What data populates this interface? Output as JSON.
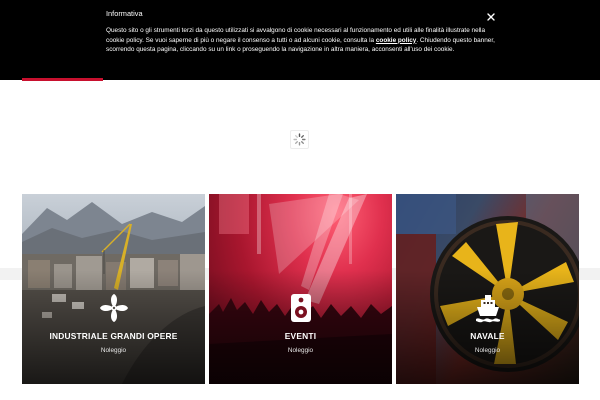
{
  "cookie_banner": {
    "title": "Informativa",
    "text_before_link": "Questo sito o gli strumenti terzi da questo utilizzati si avvalgono di cookie necessari al funzionamento ed utili alle finalità illustrate nella cookie policy. Se vuoi saperne di più o negare il consenso a tutti o ad alcuni cookie, consulta la ",
    "link_text": "cookie policy",
    "text_after_link": ". Chiudendo questo banner, scorrendo questa pagina, cliccando su un link o proseguendo la navigazione in altra maniera, acconsenti all'uso dei cookie.",
    "close_icon": "close-icon"
  },
  "loader": {
    "icon": "spinner-icon"
  },
  "cards": [
    {
      "title": "INDUSTRIALE GRANDI OPERE",
      "subtitle": "Noleggio",
      "icon": "fan-icon"
    },
    {
      "title": "EVENTI",
      "subtitle": "Noleggio",
      "icon": "speaker-icon"
    },
    {
      "title": "NAVALE",
      "subtitle": "Noleggio",
      "icon": "ship-icon"
    }
  ],
  "colors": {
    "accent": "#c8102e",
    "banner_background": "#000000",
    "card_text": "#ffffff"
  }
}
